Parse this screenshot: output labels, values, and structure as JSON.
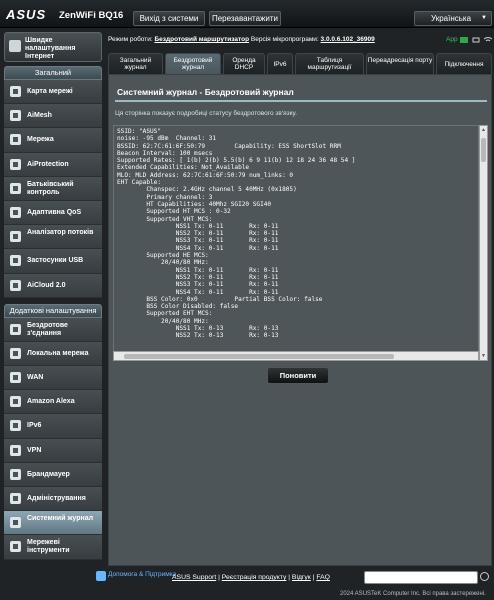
{
  "header": {
    "logo": "ASUS",
    "model": "ZenWiFi BQ16",
    "logout_label": "Вихід з системи",
    "reboot_label": "Перезавантажити",
    "language": "Українська"
  },
  "status": {
    "mode_label": "Режим роботи:",
    "mode_value": "Бездротовий маршрутизатор",
    "fw_label": "Версія мікропрограми:",
    "fw_value": "3.0.0.6.102_36909",
    "app_label": "App"
  },
  "sidebar": {
    "quick_label": "Швидке налаштування Інтернет",
    "general_header": "Загальний",
    "general_items": [
      {
        "label": "Карта мережі",
        "icon": "network-map-icon"
      },
      {
        "label": "AiMesh",
        "icon": "aimesh-icon"
      },
      {
        "label": "Мережа",
        "icon": "network-icon"
      },
      {
        "label": "AiProtection",
        "icon": "shield-icon"
      },
      {
        "label": "Батьківський контроль",
        "icon": "parental-control-icon"
      },
      {
        "label": "Адаптивна QoS",
        "icon": "qos-icon"
      },
      {
        "label": "Аналізатор потоків",
        "icon": "traffic-analyzer-icon"
      },
      {
        "label": "Застосунки USB",
        "icon": "usb-icon"
      },
      {
        "label": "AiCloud 2.0",
        "icon": "cloud-icon"
      }
    ],
    "advanced_header": "Додаткові налаштування",
    "advanced_items": [
      {
        "label": "Бездротове з'єднання",
        "icon": "wireless-icon"
      },
      {
        "label": "Локальна мережа",
        "icon": "lan-icon"
      },
      {
        "label": "WAN",
        "icon": "wan-icon"
      },
      {
        "label": "Amazon Alexa",
        "icon": "alexa-icon"
      },
      {
        "label": "IPv6",
        "icon": "ipv6-icon"
      },
      {
        "label": "VPN",
        "icon": "vpn-icon"
      },
      {
        "label": "Брандмауер",
        "icon": "firewall-icon"
      },
      {
        "label": "Адміністрування",
        "icon": "admin-icon"
      },
      {
        "label": "Системний журнал",
        "icon": "system-log-icon"
      },
      {
        "label": "Мережеві інструменти",
        "icon": "network-tools-icon"
      }
    ]
  },
  "tabs": [
    "Загальний журнал",
    "Бездротовий журнал",
    "Оренда DHCP",
    "IPv6",
    "Таблиця маршрутизації",
    "Переадресація порту",
    "Підключення"
  ],
  "main": {
    "title": "Системний журнал - Бездротовий журнал",
    "description": "Ця сторінка показує подробиці статусу бездротового зв'язку.",
    "log_text": "SSID: \"ASUS\"\nnoise: -95 dBm  Channel: 31\nBSSID: 62:7C:61:6F:50:79        Capability: ESS ShortSlot RRM\nBeacon Interval: 100 msecs\nSupported Rates: [ 1(b) 2(b) 5.5(b) 6 9 11(b) 12 18 24 36 48 54 ]\nExtended Capabilities: Not_Available\nMLO: MLD Address: 62:7C:61:6F:50:79 num_links: 0\nEHT Capable:\n        Chanspec: 2.4GHz channel 5 40MHz (0x1805)\n        Primary channel: 3\n        HT Capabilities: 40Mhz SGI20 SGI40\n        Supported HT MCS : 0-32\n        Supported VHT MCS:\n                NSS1 Tx: 0-11       Rx: 0-11\n                NSS2 Tx: 0-11       Rx: 0-11\n                NSS3 Tx: 0-11       Rx: 0-11\n                NSS4 Tx: 0-11       Rx: 0-11\n        Supported HE MCS:\n            20/40/80 MHz:\n                NSS1 Tx: 0-11       Rx: 0-11\n                NSS2 Tx: 0-11       Rx: 0-11\n                NSS3 Tx: 0-11       Rx: 0-11\n                NSS4 Tx: 0-11       Rx: 0-11\n        BSS Color: 0x0          Partial BSS Color: false\n        BSS Color Disabled: false\n        Supported EHT MCS:\n            20/40/80 MHz:\n                NSS1 Tx: 0-13       Rx: 0-13\n                NSS2 Tx: 0-13       Rx: 0-13",
    "refresh_label": "Поновити"
  },
  "footer": {
    "help_label": "Допомога & Підтримка",
    "links": [
      "ASUS Support",
      "Реєстрація продукту",
      "Відгук",
      "FAQ"
    ],
    "copyright": "2024 ASUSTeK Computer Inc. Всі права застережені."
  },
  "colors": {
    "accent": "#9fb8c4",
    "active_menu": "#7a93a0",
    "link": "#69b7ff",
    "app_green": "#34c759"
  }
}
